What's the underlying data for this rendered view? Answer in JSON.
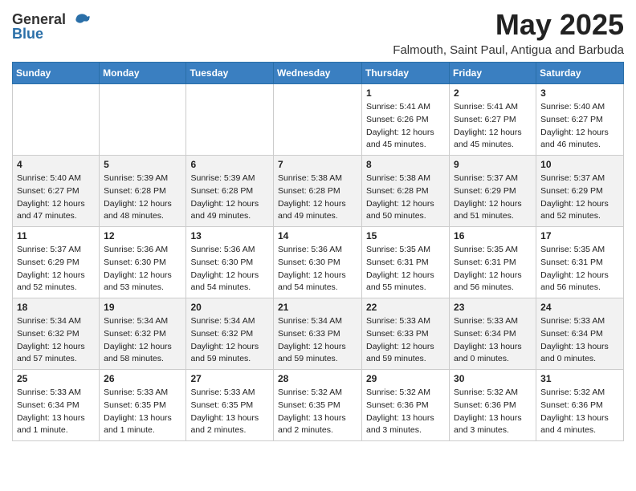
{
  "header": {
    "logo_general": "General",
    "logo_blue": "Blue",
    "month_year": "May 2025",
    "location": "Falmouth, Saint Paul, Antigua and Barbuda"
  },
  "weekdays": [
    "Sunday",
    "Monday",
    "Tuesday",
    "Wednesday",
    "Thursday",
    "Friday",
    "Saturday"
  ],
  "weeks": [
    [
      {
        "day": "",
        "info": ""
      },
      {
        "day": "",
        "info": ""
      },
      {
        "day": "",
        "info": ""
      },
      {
        "day": "",
        "info": ""
      },
      {
        "day": "1",
        "info": "Sunrise: 5:41 AM\nSunset: 6:26 PM\nDaylight: 12 hours\nand 45 minutes."
      },
      {
        "day": "2",
        "info": "Sunrise: 5:41 AM\nSunset: 6:27 PM\nDaylight: 12 hours\nand 45 minutes."
      },
      {
        "day": "3",
        "info": "Sunrise: 5:40 AM\nSunset: 6:27 PM\nDaylight: 12 hours\nand 46 minutes."
      }
    ],
    [
      {
        "day": "4",
        "info": "Sunrise: 5:40 AM\nSunset: 6:27 PM\nDaylight: 12 hours\nand 47 minutes."
      },
      {
        "day": "5",
        "info": "Sunrise: 5:39 AM\nSunset: 6:28 PM\nDaylight: 12 hours\nand 48 minutes."
      },
      {
        "day": "6",
        "info": "Sunrise: 5:39 AM\nSunset: 6:28 PM\nDaylight: 12 hours\nand 49 minutes."
      },
      {
        "day": "7",
        "info": "Sunrise: 5:38 AM\nSunset: 6:28 PM\nDaylight: 12 hours\nand 49 minutes."
      },
      {
        "day": "8",
        "info": "Sunrise: 5:38 AM\nSunset: 6:28 PM\nDaylight: 12 hours\nand 50 minutes."
      },
      {
        "day": "9",
        "info": "Sunrise: 5:37 AM\nSunset: 6:29 PM\nDaylight: 12 hours\nand 51 minutes."
      },
      {
        "day": "10",
        "info": "Sunrise: 5:37 AM\nSunset: 6:29 PM\nDaylight: 12 hours\nand 52 minutes."
      }
    ],
    [
      {
        "day": "11",
        "info": "Sunrise: 5:37 AM\nSunset: 6:29 PM\nDaylight: 12 hours\nand 52 minutes."
      },
      {
        "day": "12",
        "info": "Sunrise: 5:36 AM\nSunset: 6:30 PM\nDaylight: 12 hours\nand 53 minutes."
      },
      {
        "day": "13",
        "info": "Sunrise: 5:36 AM\nSunset: 6:30 PM\nDaylight: 12 hours\nand 54 minutes."
      },
      {
        "day": "14",
        "info": "Sunrise: 5:36 AM\nSunset: 6:30 PM\nDaylight: 12 hours\nand 54 minutes."
      },
      {
        "day": "15",
        "info": "Sunrise: 5:35 AM\nSunset: 6:31 PM\nDaylight: 12 hours\nand 55 minutes."
      },
      {
        "day": "16",
        "info": "Sunrise: 5:35 AM\nSunset: 6:31 PM\nDaylight: 12 hours\nand 56 minutes."
      },
      {
        "day": "17",
        "info": "Sunrise: 5:35 AM\nSunset: 6:31 PM\nDaylight: 12 hours\nand 56 minutes."
      }
    ],
    [
      {
        "day": "18",
        "info": "Sunrise: 5:34 AM\nSunset: 6:32 PM\nDaylight: 12 hours\nand 57 minutes."
      },
      {
        "day": "19",
        "info": "Sunrise: 5:34 AM\nSunset: 6:32 PM\nDaylight: 12 hours\nand 58 minutes."
      },
      {
        "day": "20",
        "info": "Sunrise: 5:34 AM\nSunset: 6:32 PM\nDaylight: 12 hours\nand 59 minutes."
      },
      {
        "day": "21",
        "info": "Sunrise: 5:34 AM\nSunset: 6:33 PM\nDaylight: 12 hours\nand 59 minutes."
      },
      {
        "day": "22",
        "info": "Sunrise: 5:33 AM\nSunset: 6:33 PM\nDaylight: 12 hours\nand 59 minutes."
      },
      {
        "day": "23",
        "info": "Sunrise: 5:33 AM\nSunset: 6:34 PM\nDaylight: 13 hours\nand 0 minutes."
      },
      {
        "day": "24",
        "info": "Sunrise: 5:33 AM\nSunset: 6:34 PM\nDaylight: 13 hours\nand 0 minutes."
      }
    ],
    [
      {
        "day": "25",
        "info": "Sunrise: 5:33 AM\nSunset: 6:34 PM\nDaylight: 13 hours\nand 1 minute."
      },
      {
        "day": "26",
        "info": "Sunrise: 5:33 AM\nSunset: 6:35 PM\nDaylight: 13 hours\nand 1 minute."
      },
      {
        "day": "27",
        "info": "Sunrise: 5:33 AM\nSunset: 6:35 PM\nDaylight: 13 hours\nand 2 minutes."
      },
      {
        "day": "28",
        "info": "Sunrise: 5:32 AM\nSunset: 6:35 PM\nDaylight: 13 hours\nand 2 minutes."
      },
      {
        "day": "29",
        "info": "Sunrise: 5:32 AM\nSunset: 6:36 PM\nDaylight: 13 hours\nand 3 minutes."
      },
      {
        "day": "30",
        "info": "Sunrise: 5:32 AM\nSunset: 6:36 PM\nDaylight: 13 hours\nand 3 minutes."
      },
      {
        "day": "31",
        "info": "Sunrise: 5:32 AM\nSunset: 6:36 PM\nDaylight: 13 hours\nand 4 minutes."
      }
    ]
  ]
}
